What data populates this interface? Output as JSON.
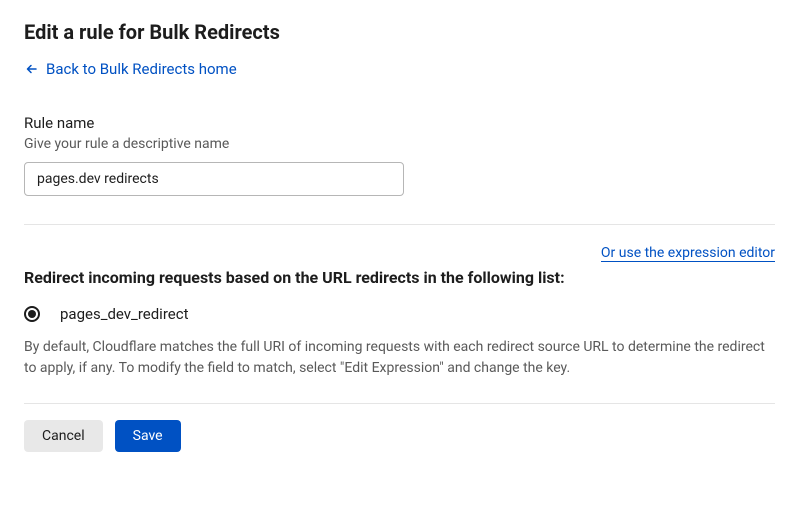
{
  "header": {
    "title": "Edit a rule for Bulk Redirects",
    "back_link": "Back to Bulk Redirects home"
  },
  "rule_name": {
    "label": "Rule name",
    "hint": "Give your rule a descriptive name",
    "value": "pages.dev redirects"
  },
  "redirect_section": {
    "expression_link": "Or use the expression editor",
    "heading": "Redirect incoming requests based on the URL redirects in the following list:",
    "options": [
      {
        "label": "pages_dev_redirect",
        "selected": true
      }
    ],
    "description": "By default, Cloudflare matches the full URI of incoming requests with each redirect source URL to determine the redirect to apply, if any. To modify the field to match, select \"Edit Expression\" and change the key."
  },
  "footer": {
    "cancel": "Cancel",
    "save": "Save"
  }
}
